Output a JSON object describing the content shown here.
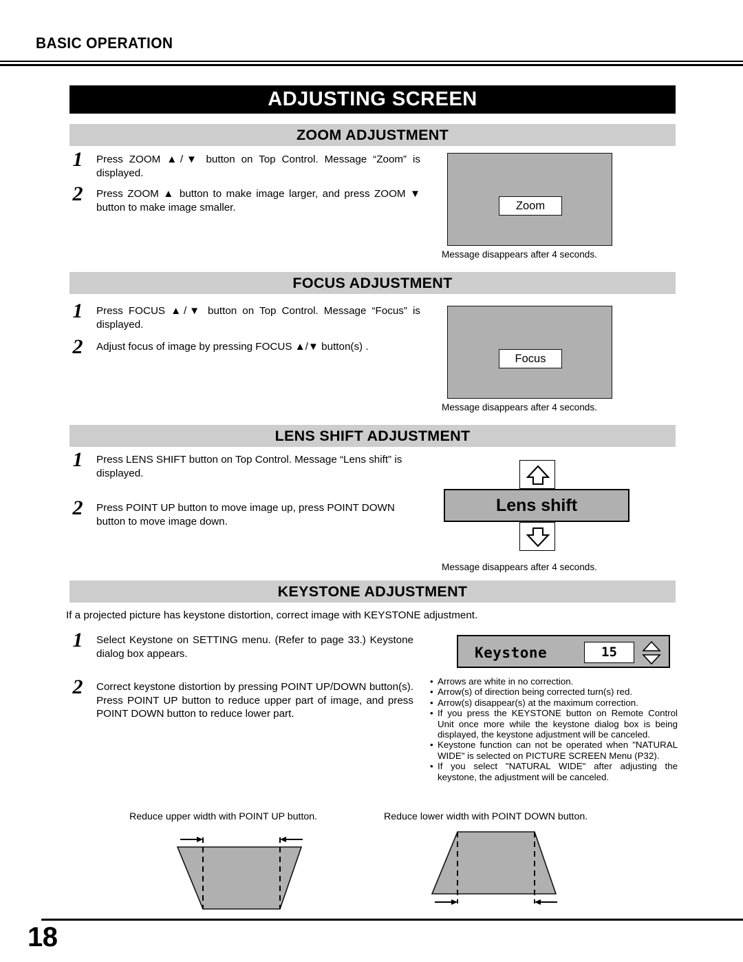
{
  "header": {
    "running_head": "BASIC OPERATION"
  },
  "banner": {
    "title": "ADJUSTING SCREEN"
  },
  "sections": {
    "zoom": {
      "bar_title": "ZOOM ADJUSTMENT",
      "steps": [
        {
          "num": "1",
          "text": "Press ZOOM ▲/▼ button on Top Control. Message “Zoom” is displayed."
        },
        {
          "num": "2",
          "text": "Press ZOOM ▲ button to make image larger, and press ZOOM ▼ button to make image smaller."
        }
      ],
      "screen_message": "Zoom",
      "caption": "Message disappears after 4 seconds."
    },
    "focus": {
      "bar_title": "FOCUS ADJUSTMENT",
      "steps": [
        {
          "num": "1",
          "text": "Press FOCUS ▲/▼ button on Top Control. Message “Focus” is displayed."
        },
        {
          "num": "2",
          "text": "Adjust focus of image by pressing FOCUS ▲/▼  button(s) ."
        }
      ],
      "screen_message": "Focus",
      "caption": "Message disappears after 4 seconds."
    },
    "lens_shift": {
      "bar_title": "LENS SHIFT ADJUSTMENT",
      "steps": [
        {
          "num": "1",
          "text": "Press LENS SHIFT button on Top Control. Message “Lens shift” is displayed."
        },
        {
          "num": "2",
          "text": "Press POINT UP button to move image up, press POINT DOWN button to move image down."
        }
      ],
      "widget_label": "Lens shift",
      "caption": "Message disappears after 4 seconds."
    },
    "keystone": {
      "bar_title": "KEYSTONE ADJUSTMENT",
      "intro": "If a projected picture has keystone distortion, correct image with KEYSTONE adjustment.",
      "steps": [
        {
          "num": "1",
          "text": "Select Keystone on SETTING menu. (Refer to page 33.) Keystone dialog box appears."
        },
        {
          "num": "2",
          "text": "Correct keystone distortion by pressing POINT UP/DOWN button(s).  Press POINT UP button to reduce upper part of image, and press  POINT DOWN button to reduce lower part."
        }
      ],
      "dialog": {
        "label": "Keystone",
        "value": "15"
      },
      "notes": [
        "Arrows are white in no correction.",
        "Arrow(s) of direction being corrected turn(s) red.",
        "Arrow(s) disappear(s) at the maximum correction.",
        "If you press the KEYSTONE button on Remote Control Unit once more while the keystone dialog box is being displayed, the keystone adjustment will be canceled.",
        "Keystone function can not be operated when \"NATURAL WIDE\" is selected on PICTURE SCREEN Menu (P32).",
        "If you select \"NATURAL WIDE\" after adjusting the keystone, the adjustment will be canceled."
      ],
      "diagrams": [
        {
          "caption": "Reduce upper width with POINT UP button."
        },
        {
          "caption": "Reduce lower width with POINT DOWN button."
        }
      ]
    }
  },
  "footer": {
    "page_number": "18"
  },
  "colors": {
    "bar_gray": "#cdcdcd",
    "screen_gray": "#b0b0b0",
    "dialog_gray": "#b3b3b3",
    "banner_black": "#000000"
  }
}
